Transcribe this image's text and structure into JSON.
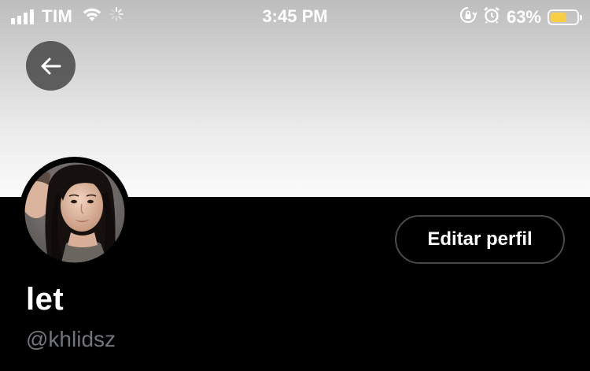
{
  "status_bar": {
    "carrier": "TIM",
    "time": "3:45 PM",
    "battery_percent": "63%",
    "battery_level": 0.63,
    "battery_color": "#f7ce46",
    "icons": [
      "signal-icon",
      "wifi-icon",
      "loading-spinner-icon",
      "orientation-lock-icon",
      "alarm-icon",
      "battery-icon"
    ]
  },
  "header": {
    "back_icon": "arrow-left-icon"
  },
  "profile": {
    "edit_button_label": "Editar perfil",
    "display_name": "let",
    "handle": "@khlidsz"
  },
  "colors": {
    "background": "#000000",
    "handle_text": "#6e767d",
    "button_border": "#4a4a4a"
  }
}
